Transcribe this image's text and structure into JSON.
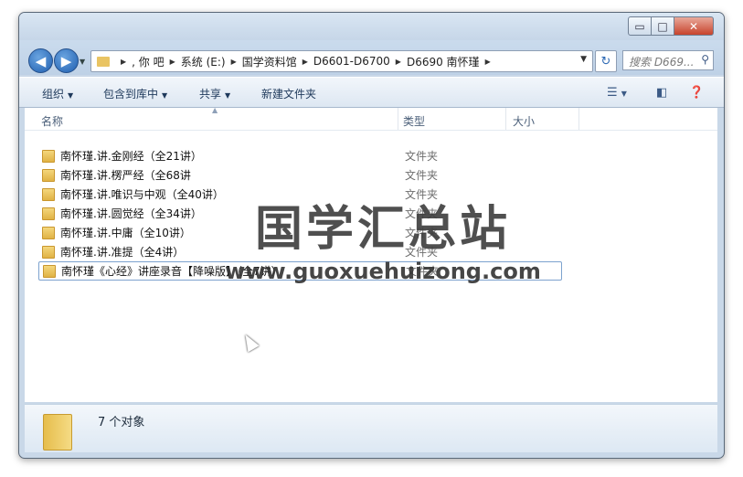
{
  "window": {
    "controls": {
      "minimize": "▭",
      "maximize": "□",
      "close": "✕"
    }
  },
  "nav": {
    "back_icon": "arrow-left-icon",
    "forward_icon": "arrow-right-icon",
    "address": [
      ", 你  吧",
      "系统 (E:)",
      "国学资料馆",
      "D6601-D6700",
      "D6690 南怀瑾"
    ],
    "search_placeholder": "搜索 D669..."
  },
  "toolbar": {
    "organize": "组织",
    "include_in_library": "包含到库中",
    "share": "共享",
    "new_folder": "新建文件夹"
  },
  "columns": {
    "name": "名称",
    "type": "类型",
    "size": "大小"
  },
  "files": [
    {
      "name": "南怀瑾.讲.金刚经（全21讲）",
      "type": "文件夹"
    },
    {
      "name": "南怀瑾.讲.楞严经（全68讲",
      "type": "文件夹"
    },
    {
      "name": "南怀瑾.讲.唯识与中观（全40讲）",
      "type": "文件夹"
    },
    {
      "name": "南怀瑾.讲.圆觉经（全34讲）",
      "type": "文件夹"
    },
    {
      "name": "南怀瑾.讲.中庸（全10讲）",
      "type": "文件夹"
    },
    {
      "name": "南怀瑾.讲.准提（全4讲）",
      "type": "文件夹"
    },
    {
      "name": "南怀瑾《心经》讲座录音【降噪版】（全7讲）",
      "type": "文件夹"
    }
  ],
  "watermark": {
    "title": "国学汇总站",
    "url": "www.guoxuehuizong.com"
  },
  "status": {
    "count": "7 个对象"
  }
}
